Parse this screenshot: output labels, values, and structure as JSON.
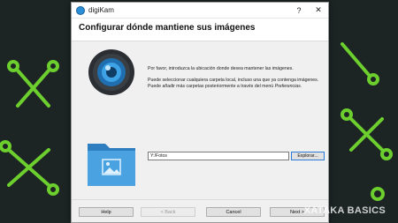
{
  "window": {
    "title": "digiKam",
    "help_glyph": "?",
    "close_glyph": "✕"
  },
  "page": {
    "heading": "Configurar dónde mantiene sus imágenes",
    "paragraph1": "Por favor, introduzca la ubicación donde desea mantener las imágenes.",
    "paragraph2_line1": "Puede seleccionar cualquiera carpeta local, incluso una que ya contenga imágenes.",
    "paragraph2_line2_prefix": "Puede añadir más carpetas posteriormente a través del menú ",
    "paragraph2_line2_em": "Preferencias",
    "paragraph2_line2_suffix": "."
  },
  "path": {
    "value": "Y:/Fotos",
    "browse_label": "Explorar..."
  },
  "footer": {
    "help_label": "Help",
    "back_label": "< Back",
    "cancel_label": "Cancel",
    "next_label": "Next >"
  },
  "watermark": {
    "text": "XATAKA BASICS"
  },
  "icons": {
    "app": "digikam-icon",
    "lens": "camera-lens-icon",
    "folder": "pictures-folder-icon"
  }
}
